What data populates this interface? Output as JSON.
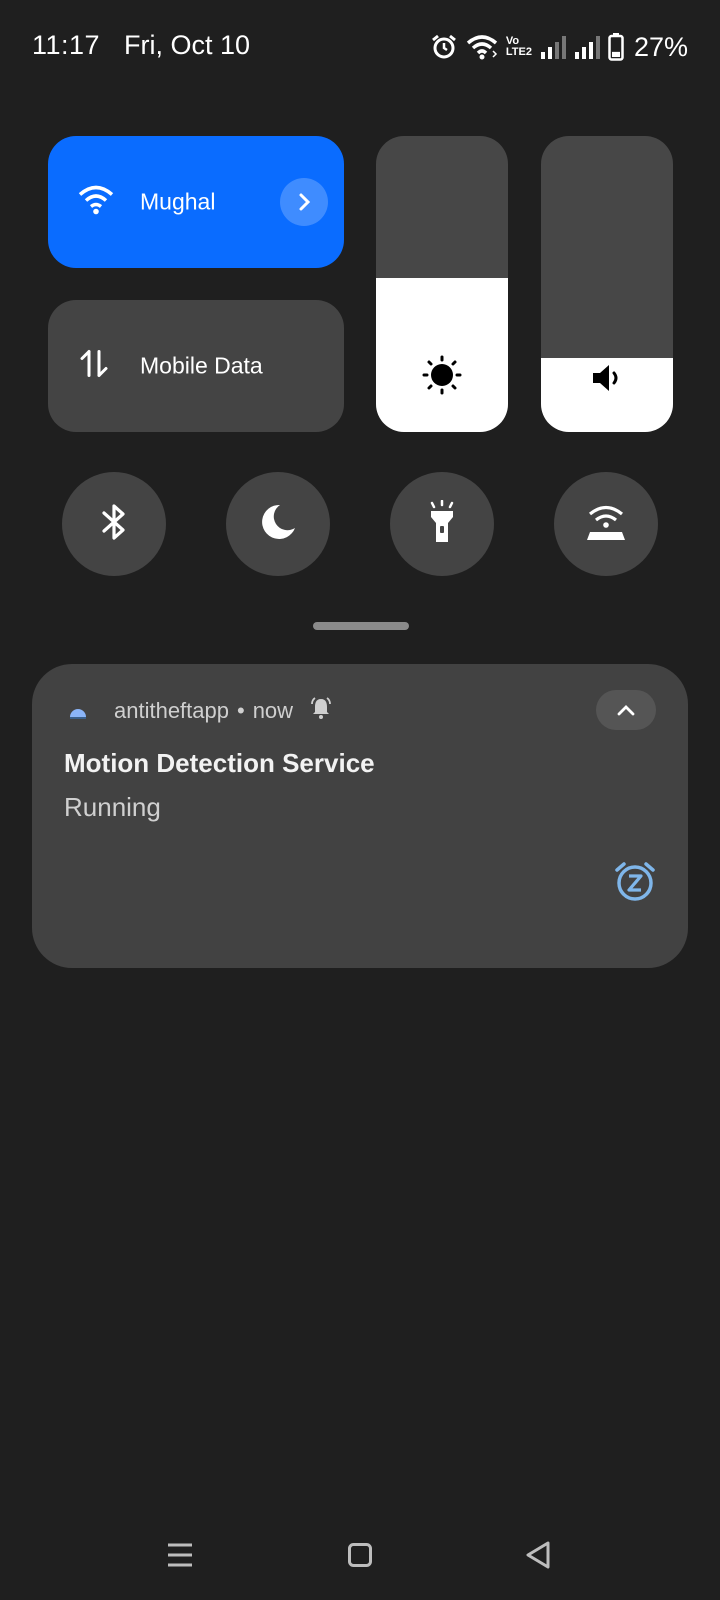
{
  "status_bar": {
    "time": "11:17",
    "date": "Fri, Oct 10",
    "icons": [
      "alarm-icon",
      "wifi-icon",
      "volte-icon",
      "signal-icon",
      "signal-icon",
      "battery-icon"
    ],
    "volte_top": "Vo",
    "volte_bottom": "LTE2",
    "battery_percent": "27%",
    "battery_level": 0.27
  },
  "quick_settings": {
    "wifi_tile": {
      "label": "Mughal",
      "icon": "wifi-icon",
      "active": true,
      "accent": "#0a6cff"
    },
    "data_tile": {
      "label": "Mobile Data",
      "icon": "data-arrows-icon",
      "active": false
    },
    "brightness_level": 0.52,
    "volume_level": 0.25,
    "toggles": [
      {
        "name": "bluetooth",
        "icon": "bluetooth-icon"
      },
      {
        "name": "night-mode",
        "icon": "moon-icon"
      },
      {
        "name": "flashlight",
        "icon": "flashlight-icon"
      },
      {
        "name": "hotspot",
        "icon": "hotspot-icon"
      }
    ]
  },
  "notification": {
    "app_name": "antitheftapp",
    "separator": "•",
    "time": "now",
    "title": "Motion Detection Service",
    "text": "Running",
    "icons": [
      "android-icon",
      "bell-icon",
      "chevron-up-icon",
      "snooze-icon"
    ],
    "snooze_color": "#7fb6ea"
  },
  "nav_bar": {
    "buttons": [
      "menu-icon",
      "home-icon",
      "back-icon"
    ]
  }
}
